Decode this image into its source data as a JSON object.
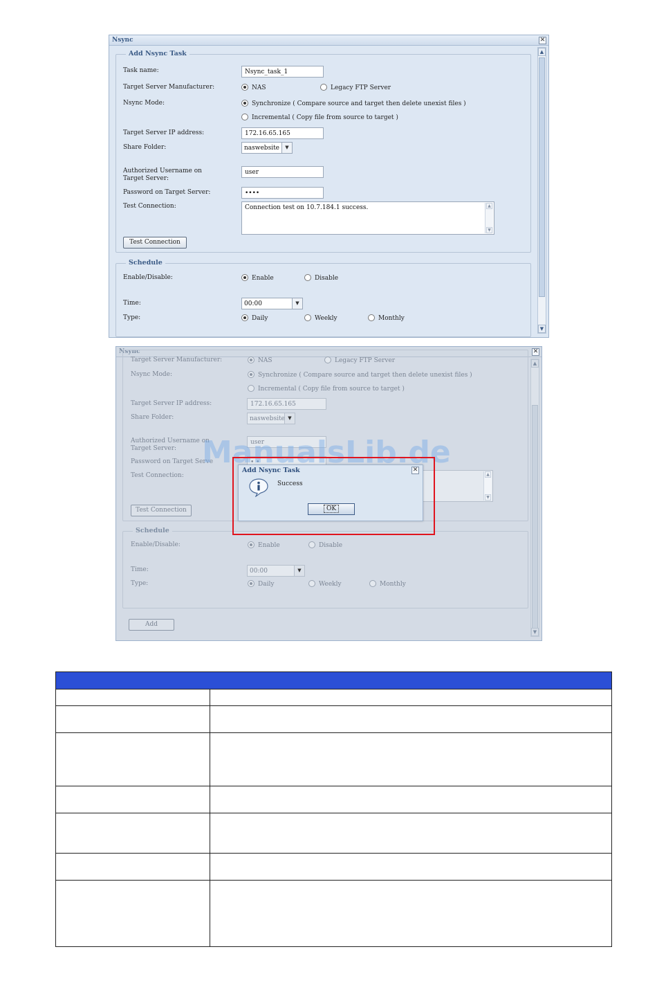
{
  "window_top": {
    "title": "Nsync",
    "close_glyph": "✕",
    "add_task": {
      "legend": "Add Nsync Task",
      "task_name": {
        "label": "Task name:",
        "value": "Nsync_task_1"
      },
      "manufacturer": {
        "label": "Target Server Manufacturer:",
        "options": [
          "NAS",
          "Legacy FTP Server"
        ],
        "selected": "NAS"
      },
      "mode": {
        "label": "Nsync Mode:",
        "options": [
          "Synchronize ( Compare source and target then delete unexist files )",
          "Incremental ( Copy file from source to target )"
        ],
        "selected": "Synchronize"
      },
      "ip": {
        "label": "Target Server IP address:",
        "value": "172.16.65.165"
      },
      "share_folder": {
        "label": "Share Folder:",
        "value": "naswebsite"
      },
      "username": {
        "label": "Authorized Username on Target Server:",
        "value": "user"
      },
      "password": {
        "label": "Password on Target Server:",
        "value": "••••"
      },
      "test_connection": {
        "label": "Test Connection:",
        "result": "Connection test on 10.7.184.1 success."
      },
      "test_button": "Test Connection"
    },
    "schedule": {
      "legend": "Schedule",
      "enable": {
        "label": "Enable/Disable:",
        "options": [
          "Enable",
          "Disable"
        ],
        "selected": "Enable"
      },
      "time": {
        "label": "Time:",
        "value": "00:00"
      },
      "type": {
        "label": "Type:",
        "options": [
          "Daily",
          "Weekly",
          "Monthly"
        ],
        "selected": "Daily"
      }
    }
  },
  "window_bottom": {
    "title": "Nsync",
    "close_glyph": "✕",
    "partial_manufacturer": {
      "label": "Target Server Manufacturer:",
      "options": [
        "NAS",
        "Legacy FTP Server"
      ]
    },
    "mode": {
      "label": "Nsync Mode:",
      "options": [
        "Synchronize ( Compare source and target then delete unexist files )",
        "Incremental ( Copy file from source to target )"
      ]
    },
    "ip": {
      "label": "Target Server IP address:",
      "value": "172.16.65.165"
    },
    "share_folder": {
      "label": "Share Folder:",
      "value": "naswebsite"
    },
    "username": {
      "label": "Authorized Username on Target Server:",
      "value": "user"
    },
    "password": {
      "label": "Password on Target Serve",
      "value": "• •"
    },
    "test_connection": {
      "label": "Test Connection:"
    },
    "test_button": "Test Connection",
    "schedule": {
      "legend": "Schedule",
      "enable": {
        "label": "Enable/Disable:",
        "options": [
          "Enable",
          "Disable"
        ]
      },
      "time": {
        "label": "Time:",
        "value": "00:00"
      },
      "type": {
        "label": "Type:",
        "options": [
          "Daily",
          "Weekly",
          "Monthly"
        ]
      }
    },
    "add_button": "Add",
    "dialog": {
      "title": "Add Nsync Task",
      "message": "Success",
      "ok_label": "OK",
      "icon": "info-icon"
    }
  },
  "watermark": "ManualsLib.de",
  "table": {
    "header_color": "#2b4fd6",
    "rows": 7
  },
  "colors": {
    "window_bg": "#dde7f3",
    "accent": "#3b5b86",
    "highlight_border": "#e0141e"
  }
}
